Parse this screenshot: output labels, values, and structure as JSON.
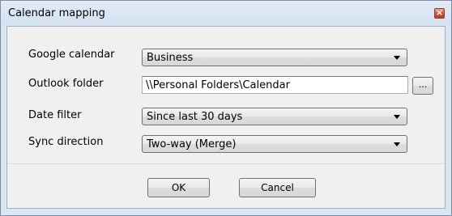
{
  "window": {
    "title": "Calendar mapping",
    "close_glyph": "×"
  },
  "form": {
    "google_calendar": {
      "label": "Google calendar",
      "value": "Business"
    },
    "outlook_folder": {
      "label": "Outlook folder",
      "value": "\\\\Personal Folders\\Calendar",
      "browse_label": "..."
    },
    "date_filter": {
      "label": "Date filter",
      "value": "Since last 30 days"
    },
    "sync_direction": {
      "label": "Sync direction",
      "value": "Two-way (Merge)"
    }
  },
  "buttons": {
    "ok_label": "OK",
    "cancel_label": "Cancel"
  },
  "colors": {
    "window_frame": "#dbe6f3",
    "close_button": "#c85a44"
  }
}
